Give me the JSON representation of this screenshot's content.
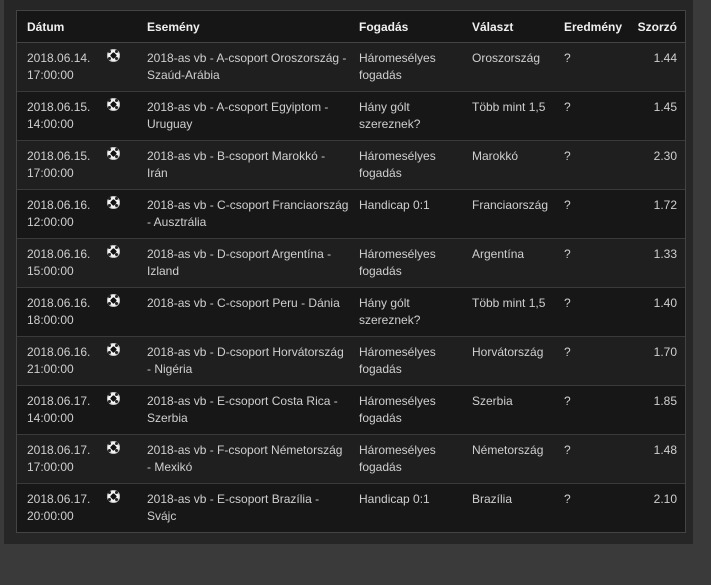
{
  "headers": {
    "date": "Dátum",
    "event": "Esemény",
    "bet": "Fogadás",
    "choice": "Választ",
    "result": "Eredmény",
    "odds": "Szorzó"
  },
  "rows": [
    {
      "date": "2018.06.14. 17:00:00",
      "sport_icon": "soccer-ball-icon",
      "event": "2018-as vb - A-csoport Oroszország - Szaúd-Arábia",
      "bet": "Háromesélyes fogadás",
      "choice": "Oroszország",
      "result": "?",
      "odds": "1.44"
    },
    {
      "date": "2018.06.15. 14:00:00",
      "sport_icon": "soccer-ball-icon",
      "event": "2018-as vb - A-csoport Egyiptom - Uruguay",
      "bet": "Hány gólt szereznek?",
      "choice": "Több mint 1,5",
      "result": "?",
      "odds": "1.45"
    },
    {
      "date": "2018.06.15. 17:00:00",
      "sport_icon": "soccer-ball-icon",
      "event": "2018-as vb - B-csoport Marokkó - Irán",
      "bet": "Háromesélyes fogadás",
      "choice": "Marokkó",
      "result": "?",
      "odds": "2.30"
    },
    {
      "date": "2018.06.16. 12:00:00",
      "sport_icon": "soccer-ball-icon",
      "event": "2018-as vb - C-csoport Franciaország - Ausztrália",
      "bet": "Handicap 0:1",
      "choice": "Franciaország",
      "result": "?",
      "odds": "1.72"
    },
    {
      "date": "2018.06.16. 15:00:00",
      "sport_icon": "soccer-ball-icon",
      "event": "2018-as vb - D-csoport Argentína - Izland",
      "bet": "Háromesélyes fogadás",
      "choice": "Argentína",
      "result": "?",
      "odds": "1.33"
    },
    {
      "date": "2018.06.16. 18:00:00",
      "sport_icon": "soccer-ball-icon",
      "event": "2018-as vb - C-csoport Peru - Dánia",
      "bet": "Hány gólt szereznek?",
      "choice": "Több mint 1,5",
      "result": "?",
      "odds": "1.40"
    },
    {
      "date": "2018.06.16. 21:00:00",
      "sport_icon": "soccer-ball-icon",
      "event": "2018-as vb - D-csoport Horvátország - Nigéria",
      "bet": "Háromesélyes fogadás",
      "choice": "Horvátország",
      "result": "?",
      "odds": "1.70"
    },
    {
      "date": "2018.06.17. 14:00:00",
      "sport_icon": "soccer-ball-icon",
      "event": "2018-as vb - E-csoport Costa Rica - Szerbia",
      "bet": "Háromesélyes fogadás",
      "choice": "Szerbia",
      "result": "?",
      "odds": "1.85"
    },
    {
      "date": "2018.06.17. 17:00:00",
      "sport_icon": "soccer-ball-icon",
      "event": "2018-as vb - F-csoport Németország - Mexikó",
      "bet": "Háromesélyes fogadás",
      "choice": "Németország",
      "result": "?",
      "odds": "1.48"
    },
    {
      "date": "2018.06.17. 20:00:00",
      "sport_icon": "soccer-ball-icon",
      "event": "2018-as vb - E-csoport Brazília - Svájc",
      "bet": "Handicap 0:1",
      "choice": "Brazília",
      "result": "?",
      "odds": "2.10"
    }
  ]
}
